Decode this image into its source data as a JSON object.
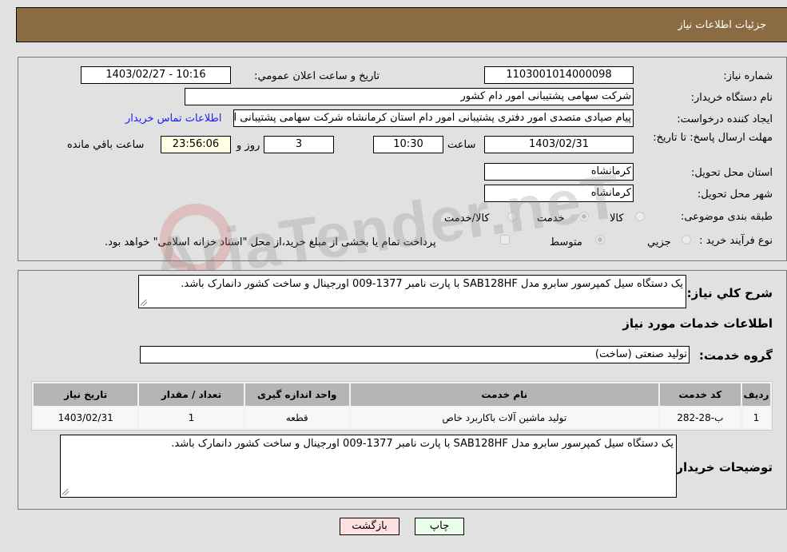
{
  "header": {
    "title": "جزئیات اطلاعات نیاز"
  },
  "details": {
    "need_number_label": "شماره نیاز:",
    "need_number": "1103001014000098",
    "announce_label": "تاريخ و ساعت اعلان عمومي:",
    "announce_value": "1403/02/27 - 10:16",
    "buyer_org_label": "نام دستگاه خريدار:",
    "buyer_org": "شرکت سهامی پشتیبانی امور دام کشور",
    "creator_label": "ايجاد کننده درخواست:",
    "creator": "پیام صیادی متصدی امور دفتری پشتیبانی امور دام استان کرمانشاه شرکت سهامی پشتیبانی امور دام کشور",
    "contact_link": "اطلاعات تماس خريدار",
    "deadline_label": "مهلت ارسال پاسخ: تا تاريخ:",
    "deadline_date": "1403/02/31",
    "time_label": "ساعت",
    "deadline_time": "10:30",
    "days_value": "3",
    "days_label": "روز و",
    "remaining_time": "23:56:06",
    "remaining_label": "ساعت باقي مانده",
    "province_label": "استان محل تحويل:",
    "province": "کرمانشاه",
    "city_label": "شهر محل تحويل:",
    "city": "کرمانشاه",
    "category_label": "طبقه بندی موضوعی:",
    "category_options": [
      "کالا",
      "خدمت",
      "کالا/خدمت"
    ],
    "category_selected": "خدمت",
    "process_label": "نوع فرآيند خريد :",
    "process_options": [
      "جزيي",
      "متوسط"
    ],
    "process_selected": "متوسط",
    "treasury_note": "پرداخت تمام يا بخشی از مبلغ خريد،از محل \"اسناد خزانه اسلامی\" خواهد بود.",
    "treasury_checked": false
  },
  "description": {
    "label": "شرح کلي نياز:",
    "text": "یک دستگاه سیل کمپرسور سابرو مدل SAB128HF با پارت نامبر 1377-009 اورجینال و ساخت کشور دانمارک باشد."
  },
  "services": {
    "section_title": "اطلاعات خدمات مورد نياز",
    "group_label": "گروه خدمت:",
    "group_value": "تولید صنعتی (ساخت)",
    "columns": [
      "رديف",
      "کد خدمت",
      "نام خدمت",
      "واحد اندازه گيری",
      "تعداد / مقدار",
      "تاريخ نياز"
    ],
    "rows": [
      [
        "1",
        "ب-28-282",
        "تولید ماشین آلات باکاربرد خاص",
        "قطعه",
        "1",
        "1403/02/31"
      ]
    ]
  },
  "buyer_notes": {
    "label": "توضيحات خريدار:",
    "text": "یک دستگاه سیل کمپرسور سابرو مدل SAB128HF با پارت نامبر 1377-009 اورجینال و ساخت کشور دانمارک باشد."
  },
  "buttons": {
    "print": "چاپ",
    "back": "بازگشت"
  },
  "colors": {
    "header_bg": "#8b6c42",
    "print_bg": "#eaffea",
    "back_bg": "#ffe0e0",
    "link": "#1a1aff",
    "remaining_bg": "#ffffe6"
  },
  "watermark": "AriaTender.neT"
}
